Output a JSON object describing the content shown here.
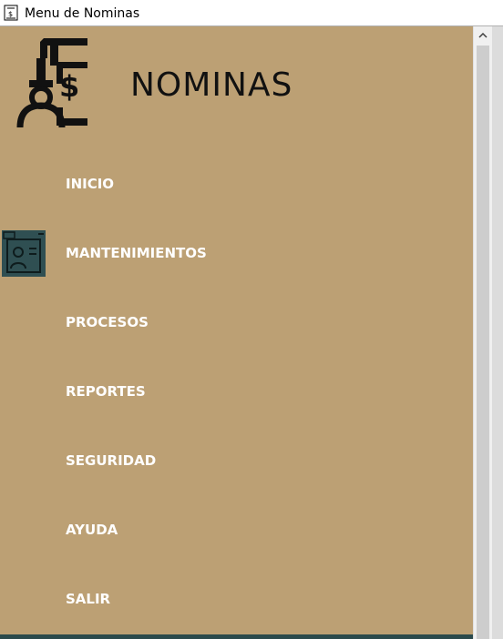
{
  "window": {
    "title": "Menu de Nominas",
    "icon": "payroll-app-icon"
  },
  "logo": {
    "icon": "payroll-logo-icon",
    "title": "NOMINAS"
  },
  "menu": {
    "items": [
      {
        "label": "INICIO"
      },
      {
        "label": "MANTENIMIENTOS",
        "icon": "employee-id-card-icon"
      },
      {
        "label": "PROCESOS"
      },
      {
        "label": "REPORTES"
      },
      {
        "label": "SEGURIDAD"
      },
      {
        "label": "AYUDA"
      },
      {
        "label": "SALIR"
      }
    ]
  },
  "colors": {
    "panel_background": "#bca074",
    "menu_text": "#ffffff",
    "logo_text": "#111111",
    "accent_dark": "#2b4a4c"
  },
  "scrollbar": {
    "up_arrow_icon": "chevron-up-icon"
  }
}
